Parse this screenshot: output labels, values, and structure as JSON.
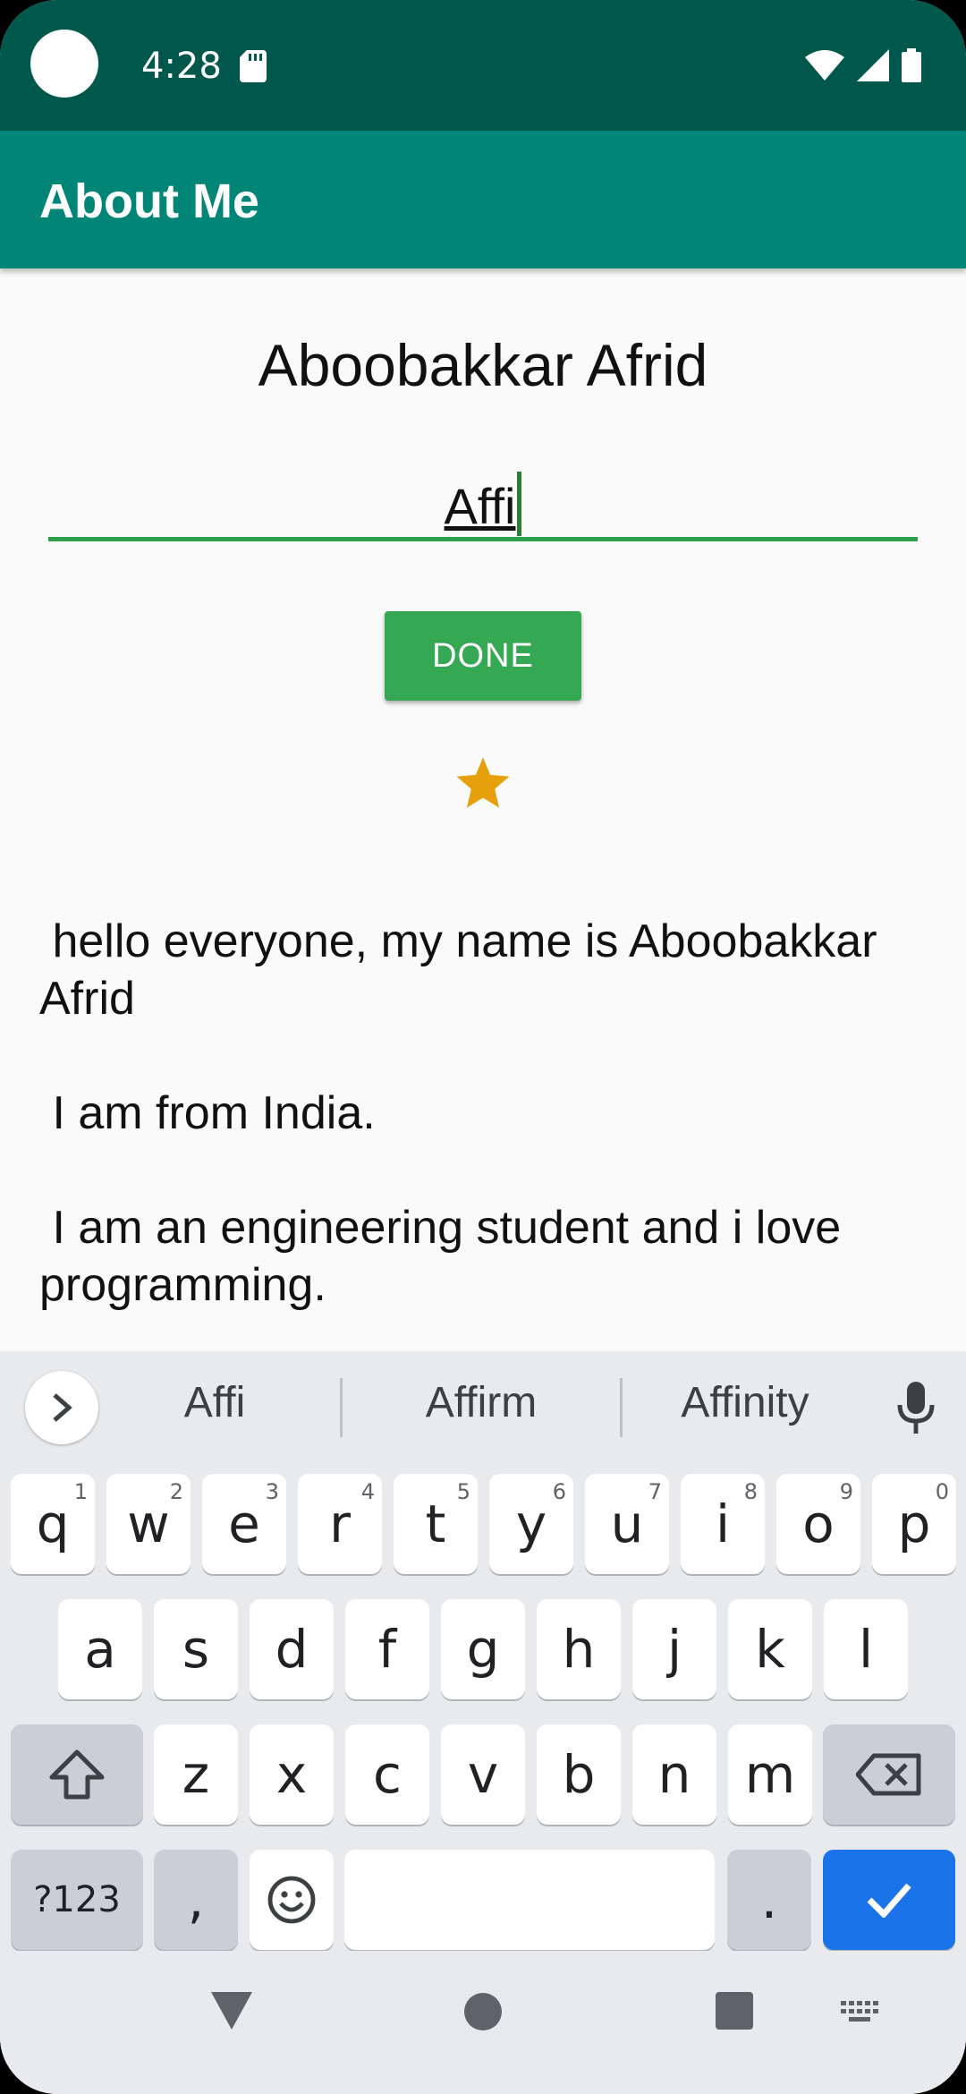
{
  "status_bar": {
    "time": "4:28"
  },
  "app_bar": {
    "title": "About Me"
  },
  "profile": {
    "name": "Aboobakkar Afrid",
    "nickname_value": "Affi",
    "done_label": "DONE",
    "accent_color": "#35a853",
    "star_color": "#e6a00c"
  },
  "bio": {
    "line1": " hello everyone, my name is Aboobakkar Afrid",
    "line2": " I am from India.",
    "line3": " I am an engineering student and i love programming."
  },
  "keyboard": {
    "suggestions": [
      "Affi",
      "Affirm",
      "Affinity"
    ],
    "row1": [
      {
        "k": "q",
        "h": "1"
      },
      {
        "k": "w",
        "h": "2"
      },
      {
        "k": "e",
        "h": "3"
      },
      {
        "k": "r",
        "h": "4"
      },
      {
        "k": "t",
        "h": "5"
      },
      {
        "k": "y",
        "h": "6"
      },
      {
        "k": "u",
        "h": "7"
      },
      {
        "k": "i",
        "h": "8"
      },
      {
        "k": "o",
        "h": "9"
      },
      {
        "k": "p",
        "h": "0"
      }
    ],
    "row2": [
      "a",
      "s",
      "d",
      "f",
      "g",
      "h",
      "j",
      "k",
      "l"
    ],
    "row3": [
      "z",
      "x",
      "c",
      "v",
      "b",
      "n",
      "m"
    ],
    "symbols_label": "?123",
    "comma_label": ",",
    "period_label": ".",
    "enter_color": "#1a73e8"
  }
}
